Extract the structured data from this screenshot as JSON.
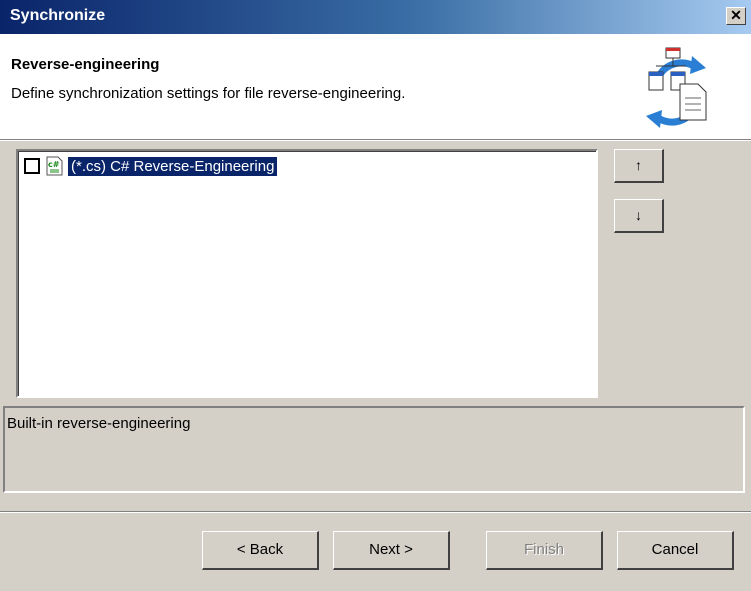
{
  "window": {
    "title": "Synchronize",
    "close_label": "✕"
  },
  "header": {
    "title": "Reverse-engineering",
    "subtitle": "Define synchronization settings for file reverse-engineering.",
    "icon": "sync-diagram-icon"
  },
  "list": {
    "items": [
      {
        "label": "(*.cs) C# Reverse-Engineering",
        "checked": false,
        "selected": true,
        "icon": "csharp-file-icon"
      }
    ]
  },
  "side_buttons": {
    "up_label": "↑",
    "down_label": "↓"
  },
  "description": {
    "text": "Built-in reverse-engineering"
  },
  "buttons": {
    "back_label": "< Back",
    "next_label": "Next >",
    "finish_label": "Finish",
    "cancel_label": "Cancel"
  },
  "colors": {
    "titlebar_start": "#0a246a",
    "titlebar_end": "#a6caf0",
    "selection": "#0a246a",
    "face": "#d4d0c8"
  }
}
